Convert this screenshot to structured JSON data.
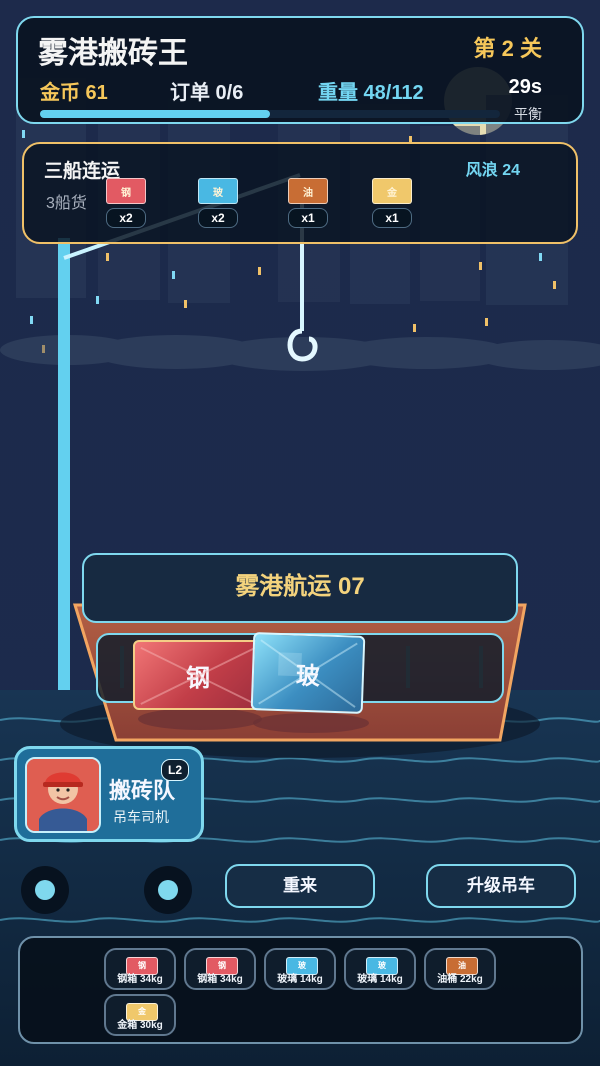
{
  "hud": {
    "game_title": "雾港搬砖王",
    "level": "第 2 关",
    "coins": "金币 61",
    "orders": "订单 0/6",
    "weight": "重量 48/112",
    "timer": "29s",
    "balance": "平衡",
    "progress": 0.5
  },
  "order": {
    "title": "三船连运",
    "subtitle": "3船货",
    "wind": "风浪 24",
    "items": [
      {
        "glyph": "钢",
        "count": "x2",
        "color": "#e25a63"
      },
      {
        "glyph": "玻",
        "count": "x2",
        "color": "#49b8e3"
      },
      {
        "glyph": "油",
        "count": "x1",
        "color": "#c86d34"
      },
      {
        "glyph": "金",
        "count": "x1",
        "color": "#f0c86b"
      }
    ]
  },
  "ship": {
    "name": "雾港航运 07",
    "cargo": [
      {
        "label": "钢"
      },
      {
        "label": "玻"
      }
    ]
  },
  "crane": {
    "title": "搬砖队",
    "subtitle": "吊车司机",
    "level_badge": "L2"
  },
  "actions": {
    "restart": "重来",
    "upgrade": "升级吊车"
  },
  "tray": {
    "items": [
      {
        "glyph": "钢",
        "label": "钢箱 34kg",
        "color": "#e25a63"
      },
      {
        "glyph": "钢",
        "label": "钢箱 34kg",
        "color": "#e25a63"
      },
      {
        "glyph": "玻",
        "label": "玻璃 14kg",
        "color": "#49b8e3"
      },
      {
        "glyph": "玻",
        "label": "玻璃 14kg",
        "color": "#49b8e3"
      },
      {
        "glyph": "油",
        "label": "油桶 22kg",
        "color": "#c86d34"
      },
      {
        "glyph": "金",
        "label": "金箱 30kg",
        "color": "#f0c86b"
      }
    ]
  }
}
